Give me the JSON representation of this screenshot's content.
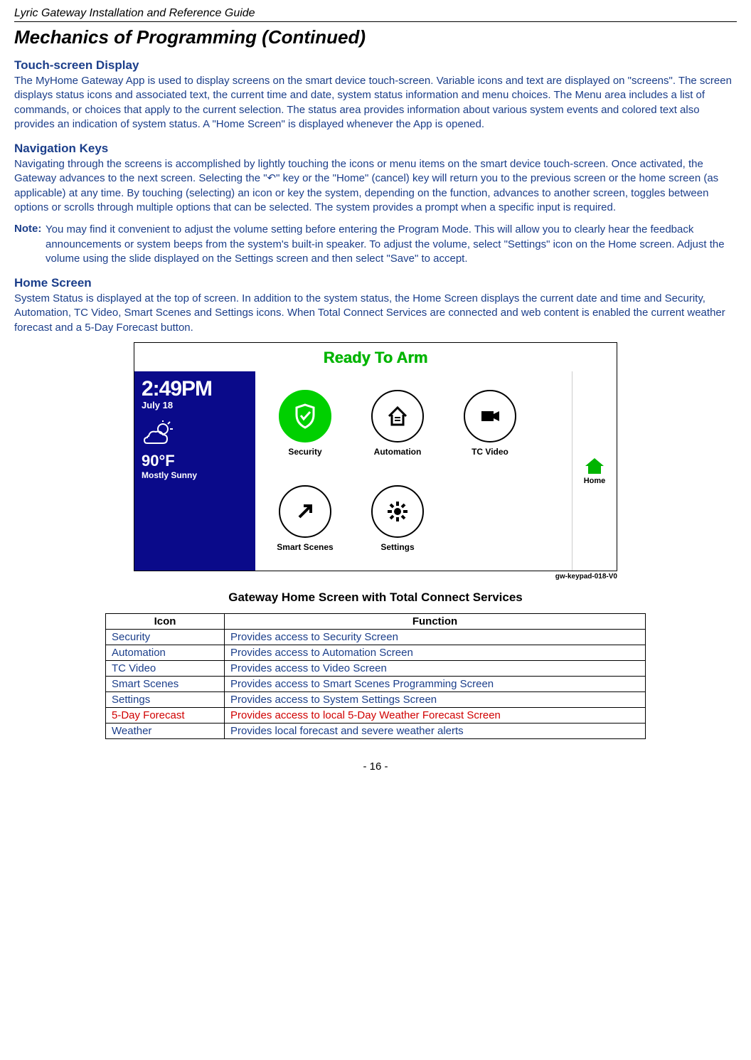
{
  "header": "Lyric Gateway Installation and Reference Guide",
  "title": "Mechanics of Programming (Continued)",
  "s1": {
    "h": "Touch-screen Display",
    "p": "The MyHome Gateway App is used to display screens on the smart device touch-screen.  Variable icons and text are displayed on \"screens\". The screen displays status icons and associated text, the current time and date, system status information and menu choices. The Menu area includes a list of commands, or choices that apply to the current selection. The status area provides information about various system events and colored text also provides an indication of system status. A \"Home Screen\" is displayed whenever the App is opened."
  },
  "s2": {
    "h": "Navigation Keys",
    "p": "Navigating through the screens is accomplished by lightly touching the icons or menu items on the smart device touch-screen. Once activated, the Gateway advances to the next screen. Selecting the \"↶\" key or the \"Home\" (cancel) key will return you to the previous screen or the home screen (as applicable) at any time.  By touching (selecting) an icon or key the system, depending on the function, advances to another screen, toggles between options or scrolls through multiple options that can be selected. The system provides a prompt when a specific input is required."
  },
  "note": {
    "label": "Note:",
    "body": "You may find it convenient to adjust the volume setting before entering the Program Mode. This will allow you to clearly hear the feedback announcements or system beeps from the system's built-in speaker. To adjust the volume, select \"Settings\" icon on the Home screen. Adjust the volume using the slide displayed on the Settings screen and then select \"Save\" to accept."
  },
  "s3": {
    "h": "Home Screen",
    "p": "System Status is displayed at the top of screen. In addition to the system status, the Home Screen displays the current date and time and Security, Automation, TC Video, Smart Scenes and Settings icons. When Total Connect Services are connected and web content is enabled the current weather forecast and a 5-Day Forecast button."
  },
  "screen": {
    "status": "Ready To Arm",
    "time": "2:49PM",
    "date": "July 18",
    "temp": "90°F",
    "cond": "Mostly Sunny",
    "icons": {
      "security": "Security",
      "automation": "Automation",
      "tcvideo": "TC Video",
      "smartscenes": "Smart Scenes",
      "settings": "Settings",
      "home": "Home"
    },
    "tag": "gw-keypad-018-V0"
  },
  "caption": "Gateway Home Screen with Total Connect Services",
  "table": {
    "h_icon": "Icon",
    "h_func": "Function",
    "rows": [
      {
        "icon": "Security",
        "func": "Provides access to Security Screen"
      },
      {
        "icon": "Automation",
        "func": "Provides access to Automation Screen"
      },
      {
        "icon": "TC Video",
        "func": "Provides access to Video Screen"
      },
      {
        "icon": "Smart Scenes",
        "func": "Provides access to Smart Scenes Programming Screen"
      },
      {
        "icon": "Settings",
        "func": "Provides access to System Settings Screen"
      },
      {
        "icon": "5-Day Forecast",
        "func": "Provides access to local 5-Day Weather Forecast Screen"
      },
      {
        "icon": "Weather",
        "func": "Provides local forecast and severe weather alerts"
      }
    ]
  },
  "page": "- 16 -"
}
